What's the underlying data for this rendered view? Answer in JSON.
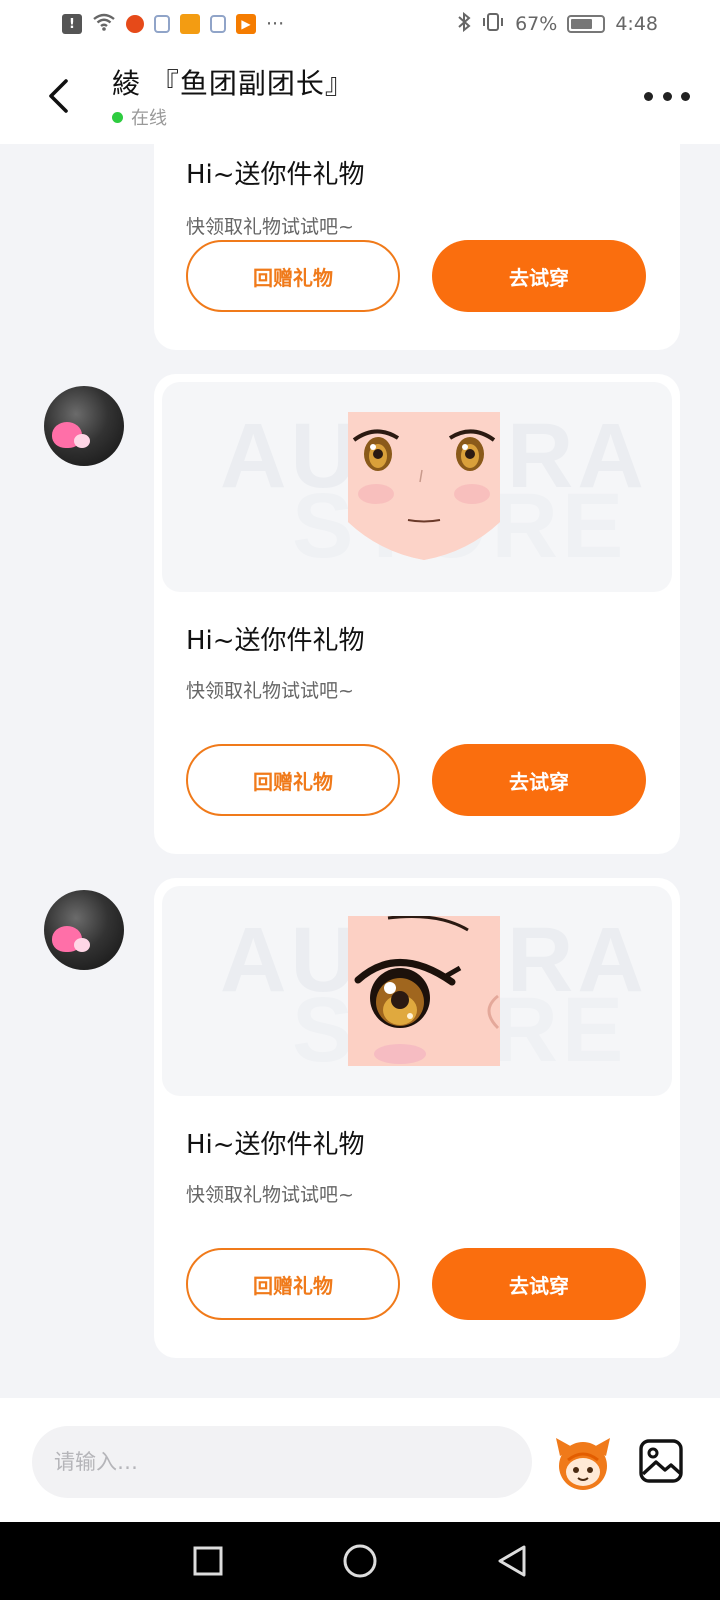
{
  "status_bar": {
    "battery_percent": "67%",
    "time": "4:48",
    "icons": [
      "alert-icon",
      "wifi-icon",
      "app-icon",
      "shield-icon",
      "shopping-icon",
      "shield-icon",
      "video-icon",
      "more-notifications-icon",
      "bluetooth-icon",
      "vibrate-icon",
      "battery-icon"
    ],
    "overflow": "···"
  },
  "header": {
    "title": "綾 『鱼团副团长』",
    "online_status": "在线"
  },
  "messages": [
    {
      "title": "Hi~送你件礼物",
      "subtitle": "快领取礼物试试吧~",
      "return_gift_label": "回赠礼物",
      "try_on_label": "去试穿"
    },
    {
      "watermark_line1": "AURORA",
      "watermark_line2": "STORE",
      "item": "face-item",
      "title": "Hi~送你件礼物",
      "subtitle": "快领取礼物试试吧~",
      "return_gift_label": "回赠礼物",
      "try_on_label": "去试穿"
    },
    {
      "watermark_line1": "AURORA",
      "watermark_line2": "STORE",
      "item": "eye-item",
      "title": "Hi~送你件礼物",
      "subtitle": "快领取礼物试试吧~",
      "return_gift_label": "回赠礼物",
      "try_on_label": "去试穿"
    }
  ],
  "input_bar": {
    "placeholder": "请输入…"
  },
  "colors": {
    "accent": "#fa6e0e",
    "online": "#2ecc40",
    "background": "#f3f4f7"
  }
}
